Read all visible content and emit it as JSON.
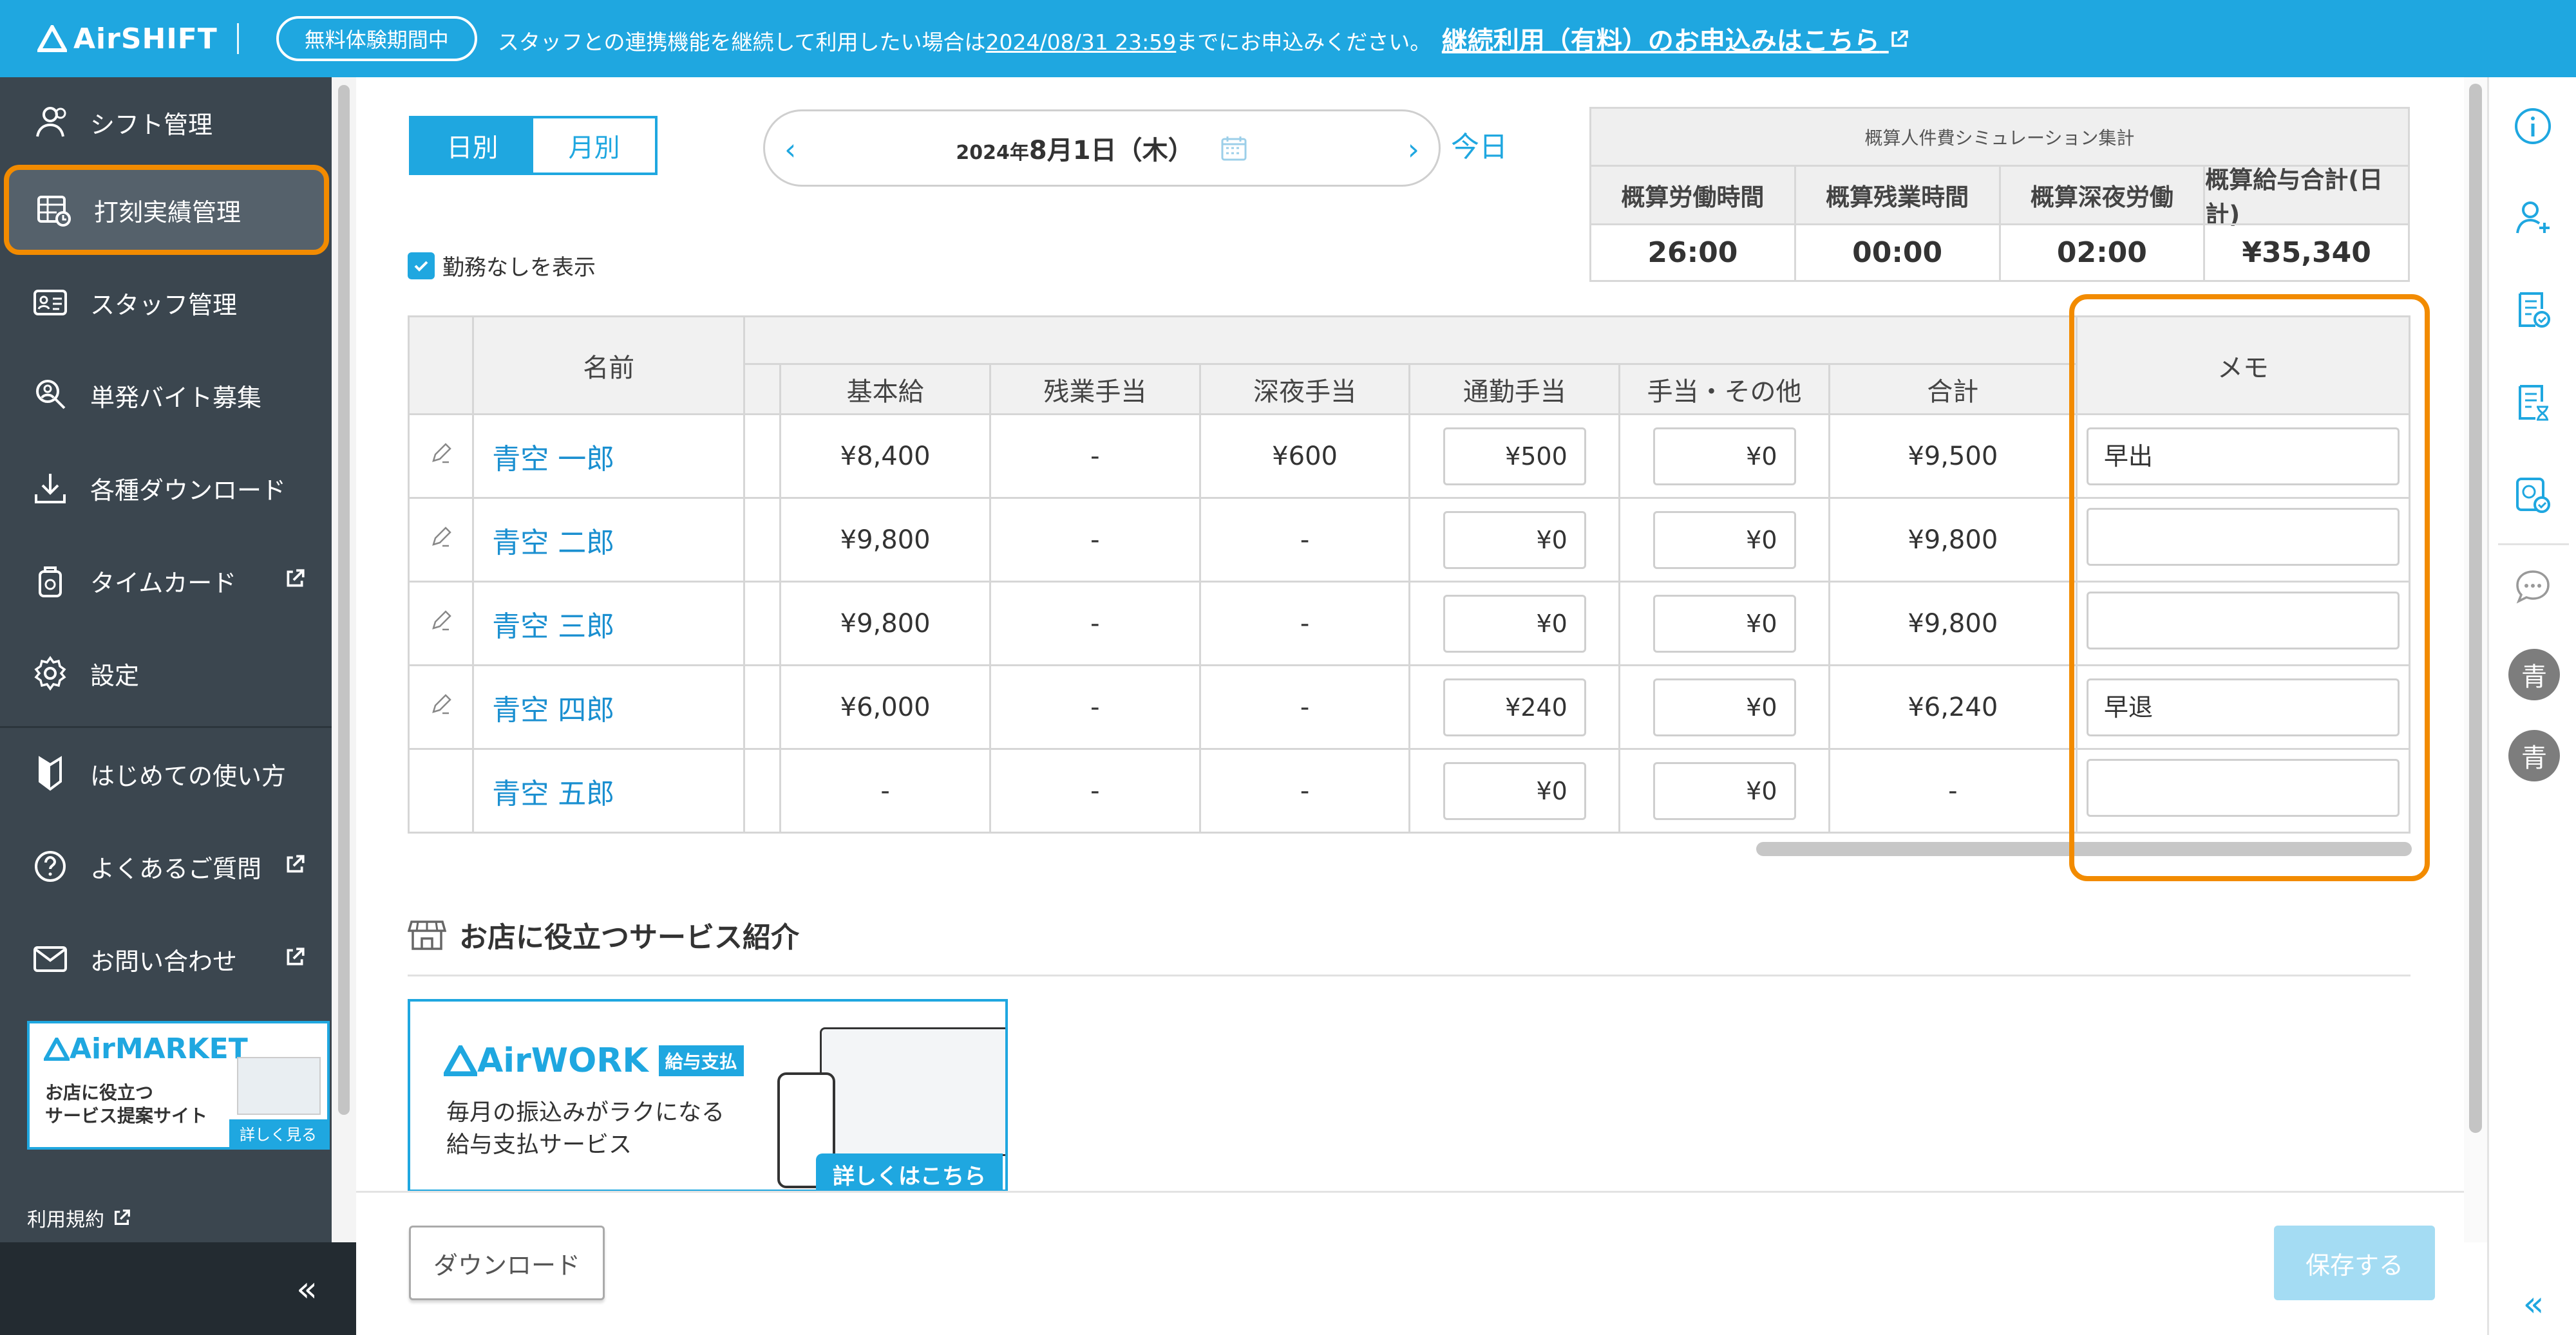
{
  "topbar": {
    "logo": "AirSHIFT",
    "trial_badge": "無料体験期間中",
    "notice_pre": "スタッフとの連携機能を継続して利用したい場合は",
    "notice_date": "2024/08/31 23:59",
    "notice_post": "までにお申込みください。",
    "notice_link": "継続利用（有料）のお申込みはこちら"
  },
  "sidebar": {
    "items": [
      {
        "label": "シフト管理"
      },
      {
        "label": "打刻実績管理"
      },
      {
        "label": "スタッフ管理"
      },
      {
        "label": "単発バイト募集"
      },
      {
        "label": "各種ダウンロード"
      },
      {
        "label": "タイムカード"
      },
      {
        "label": "設定"
      },
      {
        "label": "はじめての使い方"
      },
      {
        "label": "よくあるご質問"
      },
      {
        "label": "お問い合わせ"
      }
    ],
    "market_banner": {
      "logo": "AirMARKET",
      "line1": "お店に役立つ",
      "line2": "サービス提案サイト",
      "more": "詳しく見る"
    },
    "terms": "利用規約",
    "collapse": "«"
  },
  "view_toggle": {
    "daily": "日別",
    "monthly": "月別"
  },
  "date_nav": {
    "year": "2024年",
    "date": "8月1日（木）",
    "prev": "‹",
    "next": "›",
    "today": "今日"
  },
  "show_no_work": "勤務なしを表示",
  "summary": {
    "caption": "概算人件費シミュレーション集計",
    "headers": [
      "概算労働時間",
      "概算残業時間",
      "概算深夜労働",
      "概算給与合計(日計)"
    ],
    "values": [
      "26:00",
      "00:00",
      "02:00",
      "¥35,340"
    ]
  },
  "table": {
    "name_header": "名前",
    "columns": [
      "基本給",
      "残業手当",
      "深夜手当",
      "通勤手当",
      "手当・その他",
      "合計"
    ],
    "memo_header": "メモ",
    "rows": [
      {
        "name": "青空 一郎",
        "base": "¥8,400",
        "overtime": "-",
        "night": "¥600",
        "commute": "¥500",
        "other": "¥0",
        "total": "¥9,500",
        "memo": "早出"
      },
      {
        "name": "青空 二郎",
        "base": "¥9,800",
        "overtime": "-",
        "night": "-",
        "commute": "¥0",
        "other": "¥0",
        "total": "¥9,800",
        "memo": ""
      },
      {
        "name": "青空 三郎",
        "base": "¥9,800",
        "overtime": "-",
        "night": "-",
        "commute": "¥0",
        "other": "¥0",
        "total": "¥9,800",
        "memo": ""
      },
      {
        "name": "青空 四郎",
        "base": "¥6,000",
        "overtime": "-",
        "night": "-",
        "commute": "¥240",
        "other": "¥0",
        "total": "¥6,240",
        "memo": "早退"
      },
      {
        "name": "青空 五郎",
        "base": "-",
        "overtime": "-",
        "night": "-",
        "commute": "¥0",
        "other": "¥0",
        "total": "-",
        "memo": ""
      }
    ]
  },
  "services": {
    "title": "お店に役立つサービス紹介",
    "banner": {
      "logo": "AirWORK",
      "tag": "給与支払",
      "line1": "毎月の振込みがラクになる",
      "line2": "給与支払サービス",
      "cta": "詳しくはこちら"
    }
  },
  "footer": {
    "download": "ダウンロード",
    "save": "保存する"
  },
  "rail": {
    "avatars": [
      "青",
      "青"
    ],
    "collapse": "«"
  },
  "colors": {
    "brand": "#1fa7e0",
    "sidebar": "#3b464f",
    "highlight": "#f28b00"
  }
}
